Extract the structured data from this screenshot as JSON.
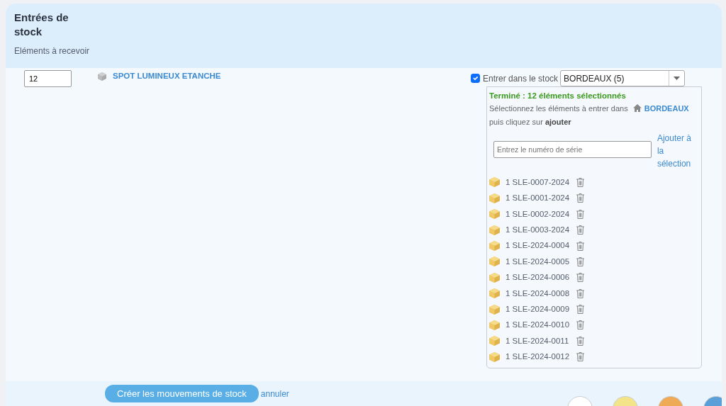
{
  "header": {
    "title": "Entrées de stock",
    "subtitle": "Eléments à recevoir"
  },
  "item": {
    "quantity": "12",
    "name": "SPOT LUMINEUX ETANCHE",
    "enter_stock": {
      "label": "Entrer dans le stock",
      "checked": true
    },
    "warehouse": "BORDEAUX (5)"
  },
  "panel": {
    "status": "Terminé : 12 éléments sélectionnés",
    "instruction_before": "Sélectionnez les éléments à entrer dans",
    "warehouse": "BORDEAUX",
    "instruction_after": "puis cliquez sur **ajouter**",
    "serial_placeholder": "Entrez le numéro de série",
    "add_link": "Ajouter à la sélection",
    "serials": [
      "1 SLE-0007-2024",
      "1 SLE-0001-2024",
      "1 SLE-0002-2024",
      "1 SLE-0003-2024",
      "1 SLE-2024-0004",
      "1 SLE-2024-0005",
      "1 SLE-2024-0006",
      "1 SLE-2024-0008",
      "1 SLE-2024-0009",
      "1 SLE-2024-0010",
      "1 SLE-2024-0011",
      "1 SLE-2024-0012"
    ]
  },
  "footer": {
    "submit": "Créer les mouvements de stock",
    "cancel": "annuler"
  },
  "corner_buttons": [
    {
      "color": "#ffffff"
    },
    {
      "color": "#f3e48a"
    },
    {
      "color": "#eeaa55"
    },
    {
      "color": "#5a9fd8"
    }
  ]
}
